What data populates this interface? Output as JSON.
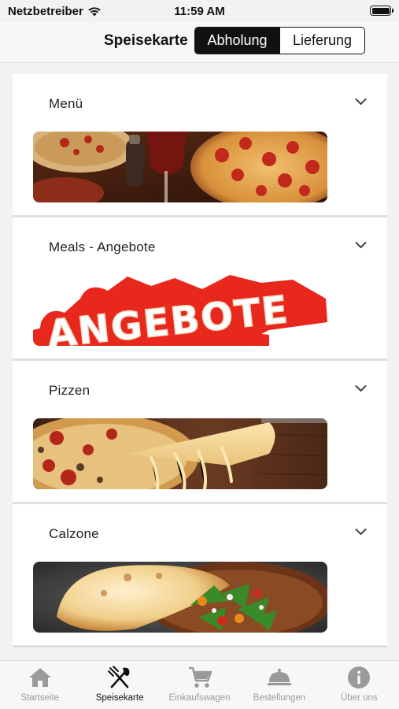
{
  "status_bar": {
    "carrier": "Netzbetreiber",
    "time": "11:59 AM"
  },
  "nav": {
    "title": "Speisekarte",
    "segments": [
      "Abholung",
      "Lieferung"
    ],
    "selected_segment": "Abholung"
  },
  "categories": [
    {
      "title": "Menü",
      "image": "pizza-pasta-photo"
    },
    {
      "title": "Meals - Angebote",
      "image": "angebote-banner",
      "banner_text": "ANGEBOTE"
    },
    {
      "title": "Pizzen",
      "image": "cheese-pizza-slice-photo"
    },
    {
      "title": "Calzone",
      "image": "calzone-salad-photo"
    }
  ],
  "tab_bar": {
    "items": [
      {
        "label": "Startseite",
        "icon": "home-icon"
      },
      {
        "label": "Speisekarte",
        "icon": "fork-knife-icon",
        "active": true
      },
      {
        "label": "Einkaufswagen",
        "icon": "cart-icon"
      },
      {
        "label": "Bestellungen",
        "icon": "cloche-icon"
      },
      {
        "label": "Über uns",
        "icon": "info-icon"
      }
    ]
  },
  "colors": {
    "accent": "#111111",
    "inactive_tab": "#9a9a9a",
    "banner_red": "#e8281c"
  }
}
